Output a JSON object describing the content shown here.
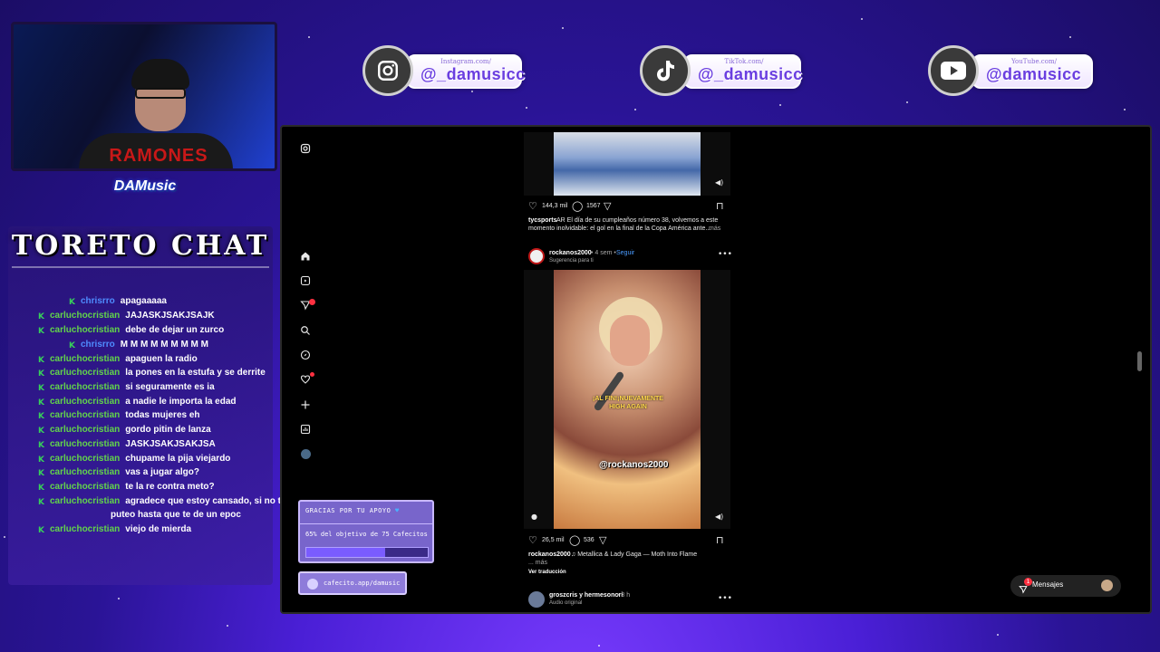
{
  "webcam": {
    "shirt_text": "RAMONES"
  },
  "overlay": {
    "logo_text": "DAMusic"
  },
  "chat": {
    "title": "TORETO CHAT",
    "messages": [
      {
        "user": "chrisrro",
        "text": "apagaaaaa",
        "color": "blue",
        "badge": "K"
      },
      {
        "user": "carluchocristian",
        "text": "JAJASKJSAKJSAJK",
        "color": "green",
        "badge": "K"
      },
      {
        "user": "carluchocristian",
        "text": "debe de dejar un zurco",
        "color": "green",
        "badge": "K"
      },
      {
        "user": "chrisrro",
        "text": "M M M M M M M M M",
        "color": "blue",
        "badge": "K"
      },
      {
        "user": "carluchocristian",
        "text": "apaguen la radio",
        "color": "green",
        "badge": "K"
      },
      {
        "user": "carluchocristian",
        "text": "la pones en la estufa y se derrite",
        "color": "green",
        "badge": "K"
      },
      {
        "user": "carluchocristian",
        "text": "si seguramente es ia",
        "color": "green",
        "badge": "K"
      },
      {
        "user": "carluchocristian",
        "text": "a nadie le importa la edad",
        "color": "green",
        "badge": "K"
      },
      {
        "user": "carluchocristian",
        "text": "todas mujeres eh",
        "color": "green",
        "badge": "K"
      },
      {
        "user": "carluchocristian",
        "text": "gordo pitin de lanza",
        "color": "green",
        "badge": "K"
      },
      {
        "user": "carluchocristian",
        "text": "JASKJSAKJSAKJSA",
        "color": "green",
        "badge": "K"
      },
      {
        "user": "carluchocristian",
        "text": "chupame la pija viejardo",
        "color": "green",
        "badge": "K"
      },
      {
        "user": "carluchocristian",
        "text": "vas a jugar algo?",
        "color": "green",
        "badge": "K"
      },
      {
        "user": "carluchocristian",
        "text": "te la re contra meto?",
        "color": "green",
        "badge": "K"
      },
      {
        "user": "carluchocristian",
        "text": "agradece que estoy cansado, si no te",
        "text2": "puteo hasta que te de un epoc",
        "color": "green",
        "badge": "K"
      },
      {
        "user": "carluchocristian",
        "text": "viejo de mierda",
        "color": "green",
        "badge": "K"
      }
    ]
  },
  "socials": [
    {
      "icon": "instagram-icon",
      "small": "Instagram.com/",
      "handle": "@_damusicc"
    },
    {
      "icon": "tiktok-icon",
      "small": "TikTok.com/",
      "handle": "@_damusicc"
    },
    {
      "icon": "youtube-icon",
      "small": "YouTube.com/",
      "handle": "@damusicc"
    }
  ],
  "feed": {
    "post1": {
      "likes": "144,3 mil",
      "comments": "1567",
      "author": "tycsports",
      "caption": "AR El día de su cumpleaños número 38, volvemos a este",
      "caption2": "momento inolvidable: el gol en la final de la Copa América ante...",
      "more": "más"
    },
    "post2": {
      "author": "rockanos2000",
      "time": "4 sem",
      "follow": "Seguir",
      "suggestion": "Sugerencia para ti",
      "caption_overlay_1": "¡AL FIN!¡NUEVAMENTE",
      "caption_overlay_2": "HIGH AGAIN",
      "watermark": "@rockanos2000",
      "likes": "26,5 mil",
      "comments": "536",
      "caption_author": "rockanos2000",
      "caption": "Metallica & Lady Gaga — Moth Into Flame",
      "more": "... más",
      "translate": "Ver traducción"
    },
    "post3": {
      "author": "groszcris y hermesonori",
      "time": "3 h",
      "audio": "Audio original"
    }
  },
  "donation": {
    "title": "GRACIAS POR TU APOYO",
    "text": "65% del objetivo de 75 Cafecitos",
    "progress": 0.65
  },
  "cafecito": {
    "link": "cafecito.app/damusic"
  },
  "messages": {
    "label": "Mensajes",
    "badge": "1"
  },
  "colors": {
    "chat_green": "#62d54a",
    "chat_blue": "#4f8cff",
    "accent_purple": "#6a3ee0",
    "notification_red": "#ff3040"
  }
}
